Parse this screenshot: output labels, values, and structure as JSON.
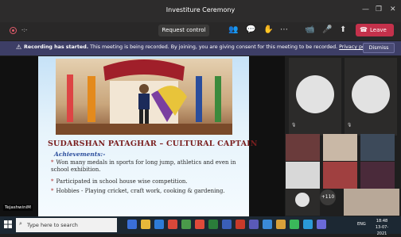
{
  "window": {
    "title": "Investiture Ceremony",
    "minimize": "—",
    "maximize": "❐",
    "close": "✕"
  },
  "meeting": {
    "timer": "-:-",
    "request_control": "Request control",
    "leave": "Leave"
  },
  "banner": {
    "prefix": "Recording has started.",
    "text": " This meeting is being recorded. By joining, you are giving consent for this meeting to be recorded. ",
    "link": "Privacy policy",
    "dismiss": "Dismiss"
  },
  "slide": {
    "heading": "SUDARSHAN PATAGHAR – CULTURAL CAPTAIN",
    "achievements_label": "Achievements:-",
    "bullets": [
      "Won many medals in sports for long jump, athletics and even in school exhibition.",
      "Participated in school house wise competition.",
      "Hobbies - Playing cricket, craft work, cooking & gardening."
    ],
    "presenter_name": "TejashwiniM"
  },
  "participants": {
    "overflow": "+110"
  },
  "taskbar": {
    "search_placeholder": "Type here to search",
    "lang": "ENG",
    "time": "18:48",
    "date": "13-07-2021"
  },
  "colors": {
    "leave_red": "#c4314b",
    "banner_purple": "#3d3e66",
    "heading_red": "#7a1f1f"
  }
}
